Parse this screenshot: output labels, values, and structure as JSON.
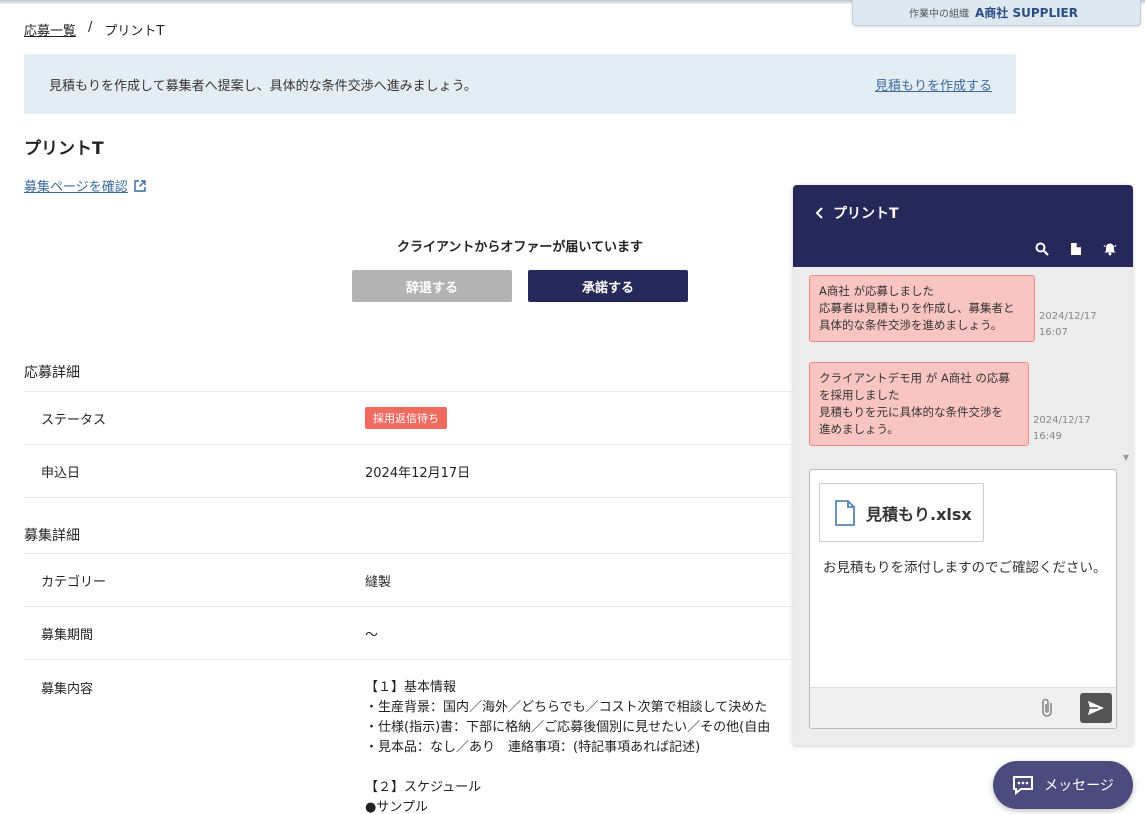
{
  "org": {
    "label": "作業中の組織",
    "name": "A商社 SUPPLIER"
  },
  "breadcrumb": {
    "parent": "応募一覧",
    "separator": "/",
    "current": "プリントT"
  },
  "banner": {
    "text": "見積もりを作成して募集者へ提案し、具体的な条件交渉へ進みましょう。",
    "link": "見積もりを作成する"
  },
  "page": {
    "title": "プリントT",
    "recruit_link": "募集ページを確認"
  },
  "offer": {
    "message": "クライアントからオファーが届いています",
    "decline": "辞退する",
    "accept": "承諾する"
  },
  "application": {
    "title": "応募詳細",
    "status_label": "ステータス",
    "status_value": "採用返信待ち",
    "date_label": "申込日",
    "date_value": "2024年12月17日"
  },
  "recruitment": {
    "title": "募集詳細",
    "category_label": "カテゴリー",
    "category_value": "縫製",
    "period_label": "募集期間",
    "period_value": "〜",
    "content_label": "募集内容",
    "content_lines": [
      "【１】基本情報",
      "・生産背景：国内／海外／どちらでも／コスト次第で相談して決めた",
      "・仕様(指示)書：下部に格納／ご応募後個別に見せたい／その他(自由",
      "・見本品：なし／あり　連絡事項：(特記事項あれば記述)",
      "",
      "【２】スケジュール",
      "●サンプル"
    ]
  },
  "chat": {
    "title": "プリントT",
    "header_icons": [
      "search-icon",
      "document-icon",
      "bell-icon"
    ],
    "messages": [
      {
        "lines": [
          "A商社 が応募しました",
          "応募者は見積もりを作成し、募集者と",
          "具体的な条件交渉を進めましょう。"
        ],
        "date": "2024/12/17",
        "time": "16:07"
      },
      {
        "lines": [
          "クライアントデモ用 が A商社 の応募",
          "を採用しました",
          "見積もりを元に具体的な条件交渉を",
          "進めましょう。"
        ],
        "date": "2024/12/17",
        "time": "16:49"
      }
    ],
    "attachment": "見積もり.xlsx",
    "draft_text": "お見積もりを添付しますのでご確認ください。",
    "colors": {
      "header": "#262859",
      "bubble": "#f9c5c2",
      "bubble_border": "#ef8a84"
    }
  },
  "message_button": {
    "label": "メッセージ"
  }
}
